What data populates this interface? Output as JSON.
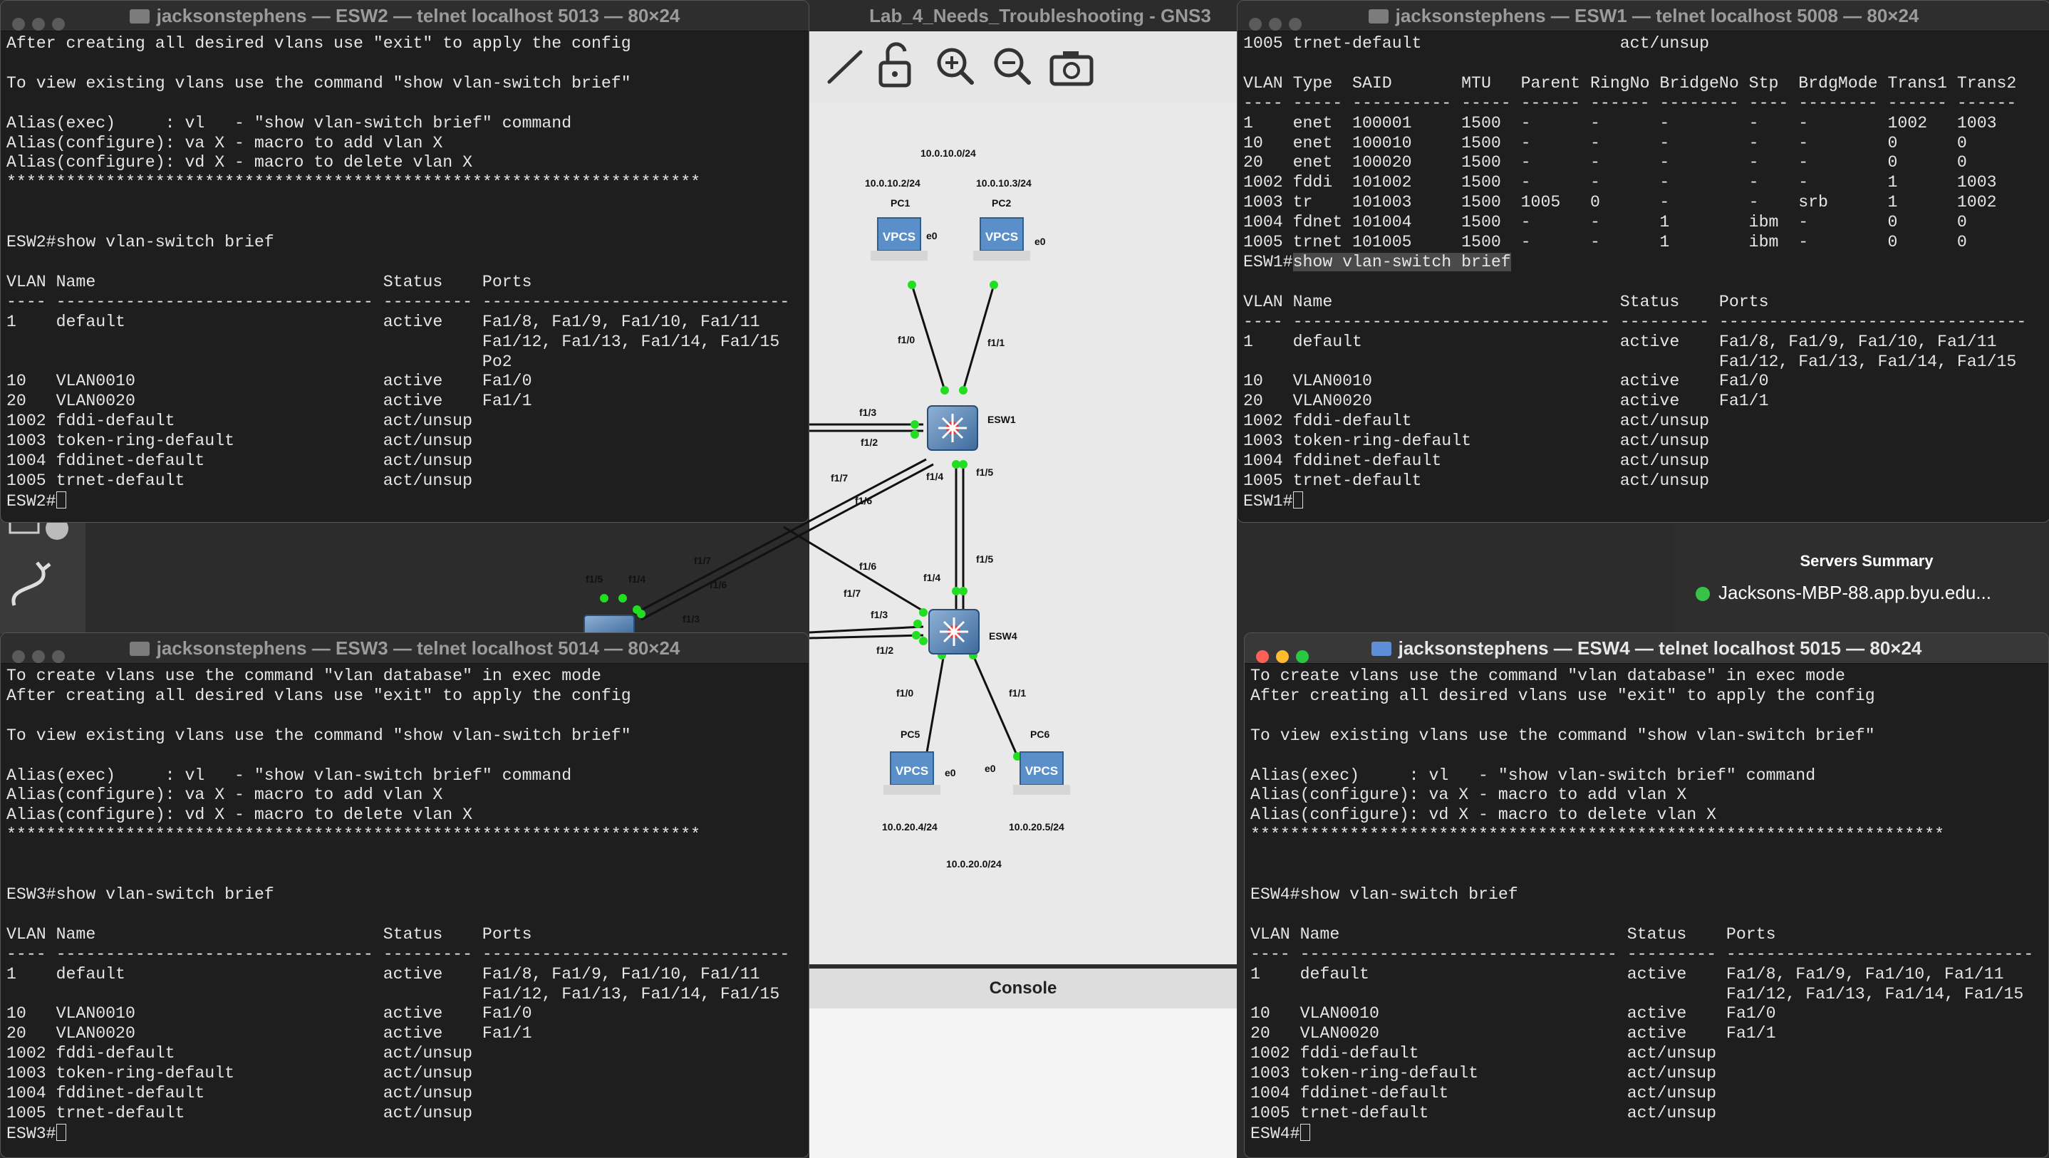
{
  "gns3": {
    "title": "Lab_4_Needs_Troubleshooting - GNS3",
    "console_label": "Console",
    "servers_summary_title": "Servers Summary",
    "server_name": "Jacksons-MBP-88.app.byu.edu...",
    "toolbar_icons": [
      "draw-line-icon",
      "unlock-icon",
      "zoom-in-icon",
      "zoom-out-icon",
      "screenshot-icon"
    ]
  },
  "topology": {
    "networks": [
      "10.0.10.0/24",
      "10.0.20.0/24"
    ],
    "pcs": [
      {
        "name": "PC1",
        "ip": "10.0.10.2/24",
        "iface": "e0",
        "badge": "VPCS"
      },
      {
        "name": "PC2",
        "ip": "10.0.10.3/24",
        "iface": "e0",
        "badge": "VPCS"
      },
      {
        "name": "PC5",
        "ip": "10.0.20.4/24",
        "iface": "e0",
        "badge": "VPCS"
      },
      {
        "name": "PC6",
        "ip": "10.0.20.5/24",
        "iface": "e0",
        "badge": "VPCS"
      }
    ],
    "switches": [
      "ESW1",
      "ESW4"
    ],
    "ports": [
      "f1/0",
      "f1/1",
      "f1/3",
      "f1/2",
      "f1/4",
      "f1/5",
      "f1/7",
      "f1/6",
      "f1/5",
      "f1/4",
      "f1/7",
      "f1/6",
      "f1/6",
      "f1/4",
      "f1/7",
      "f1/3",
      "f1/2",
      "f1/5",
      "f1/3",
      "f1/0",
      "f1/1"
    ]
  },
  "terminals": {
    "esw2": {
      "title": "jacksonstephens — ESW2 — telnet localhost 5013 — 80×24",
      "lines": [
        "After creating all desired vlans use \"exit\" to apply the config",
        "",
        "To view existing vlans use the command \"show vlan-switch brief\"",
        "",
        "Alias(exec)     : vl   - \"show vlan-switch brief\" command",
        "Alias(configure): va X - macro to add vlan X",
        "Alias(configure): vd X - macro to delete vlan X",
        "**********************************************************************",
        "",
        "",
        "ESW2#show vlan-switch brief",
        "",
        "VLAN Name                             Status    Ports",
        "---- -------------------------------- --------- -------------------------------",
        "1    default                          active    Fa1/8, Fa1/9, Fa1/10, Fa1/11",
        "                                                Fa1/12, Fa1/13, Fa1/14, Fa1/15",
        "                                                Po2",
        "10   VLAN0010                         active    Fa1/0",
        "20   VLAN0020                         active    Fa1/1",
        "1002 fddi-default                     act/unsup",
        "1003 token-ring-default               act/unsup",
        "1004 fddinet-default                  act/unsup",
        "1005 trnet-default                    act/unsup"
      ],
      "prompt": "ESW2#"
    },
    "esw1": {
      "title": "jacksonstephens — ESW1 — telnet localhost 5008 — 80×24",
      "lines_before": [
        "1005 trnet-default                    act/unsup",
        "",
        "VLAN Type  SAID       MTU   Parent RingNo BridgeNo Stp  BrdgMode Trans1 Trans2",
        "---- ----- ---------- ----- ------ ------ -------- ---- -------- ------ ------",
        "1    enet  100001     1500  -      -      -        -    -        1002   1003",
        "10   enet  100010     1500  -      -      -        -    -        0      0",
        "20   enet  100020     1500  -      -      -        -    -        0      0",
        "1002 fddi  101002     1500  -      -      -        -    -        1      1003",
        "1003 tr    101003     1500  1005   0      -        -    srb      1      1002",
        "1004 fdnet 101004     1500  -      -      1        ibm  -        0      0",
        "1005 trnet 101005     1500  -      -      1        ibm  -        0      0"
      ],
      "prompt_cmd": "ESW1#",
      "highlight_cmd": "show vlan-switch brief",
      "lines_after": [
        "",
        "VLAN Name                             Status    Ports",
        "---- -------------------------------- --------- -------------------------------",
        "1    default                          active    Fa1/8, Fa1/9, Fa1/10, Fa1/11",
        "                                                Fa1/12, Fa1/13, Fa1/14, Fa1/15",
        "10   VLAN0010                         active    Fa1/0",
        "20   VLAN0020                         active    Fa1/1",
        "1002 fddi-default                     act/unsup",
        "1003 token-ring-default               act/unsup",
        "1004 fddinet-default                  act/unsup",
        "1005 trnet-default                    act/unsup"
      ],
      "prompt": "ESW1#"
    },
    "esw3": {
      "title": "jacksonstephens — ESW3 — telnet localhost 5014 — 80×24",
      "lines": [
        "To create vlans use the command \"vlan database\" in exec mode",
        "After creating all desired vlans use \"exit\" to apply the config",
        "",
        "To view existing vlans use the command \"show vlan-switch brief\"",
        "",
        "Alias(exec)     : vl   - \"show vlan-switch brief\" command",
        "Alias(configure): va X - macro to add vlan X",
        "Alias(configure): vd X - macro to delete vlan X",
        "**********************************************************************",
        "",
        "",
        "ESW3#show vlan-switch brief",
        "",
        "VLAN Name                             Status    Ports",
        "---- -------------------------------- --------- -------------------------------",
        "1    default                          active    Fa1/8, Fa1/9, Fa1/10, Fa1/11",
        "                                                Fa1/12, Fa1/13, Fa1/14, Fa1/15",
        "10   VLAN0010                         active    Fa1/0",
        "20   VLAN0020                         active    Fa1/1",
        "1002 fddi-default                     act/unsup",
        "1003 token-ring-default               act/unsup",
        "1004 fddinet-default                  act/unsup",
        "1005 trnet-default                    act/unsup"
      ],
      "prompt": "ESW3#"
    },
    "esw4": {
      "title": "jacksonstephens — ESW4 — telnet localhost 5015 — 80×24",
      "lines": [
        "To create vlans use the command \"vlan database\" in exec mode",
        "After creating all desired vlans use \"exit\" to apply the config",
        "",
        "To view existing vlans use the command \"show vlan-switch brief\"",
        "",
        "Alias(exec)     : vl   - \"show vlan-switch brief\" command",
        "Alias(configure): va X - macro to add vlan X",
        "Alias(configure): vd X - macro to delete vlan X",
        "**********************************************************************",
        "",
        "",
        "ESW4#show vlan-switch brief",
        "",
        "VLAN Name                             Status    Ports",
        "---- -------------------------------- --------- -------------------------------",
        "1    default                          active    Fa1/8, Fa1/9, Fa1/10, Fa1/11",
        "                                                Fa1/12, Fa1/13, Fa1/14, Fa1/15",
        "10   VLAN0010                         active    Fa1/0",
        "20   VLAN0020                         active    Fa1/1",
        "1002 fddi-default                     act/unsup",
        "1003 token-ring-default               act/unsup",
        "1004 fddinet-default                  act/unsup",
        "1005 trnet-default                    act/unsup"
      ],
      "prompt": "ESW4#"
    }
  }
}
